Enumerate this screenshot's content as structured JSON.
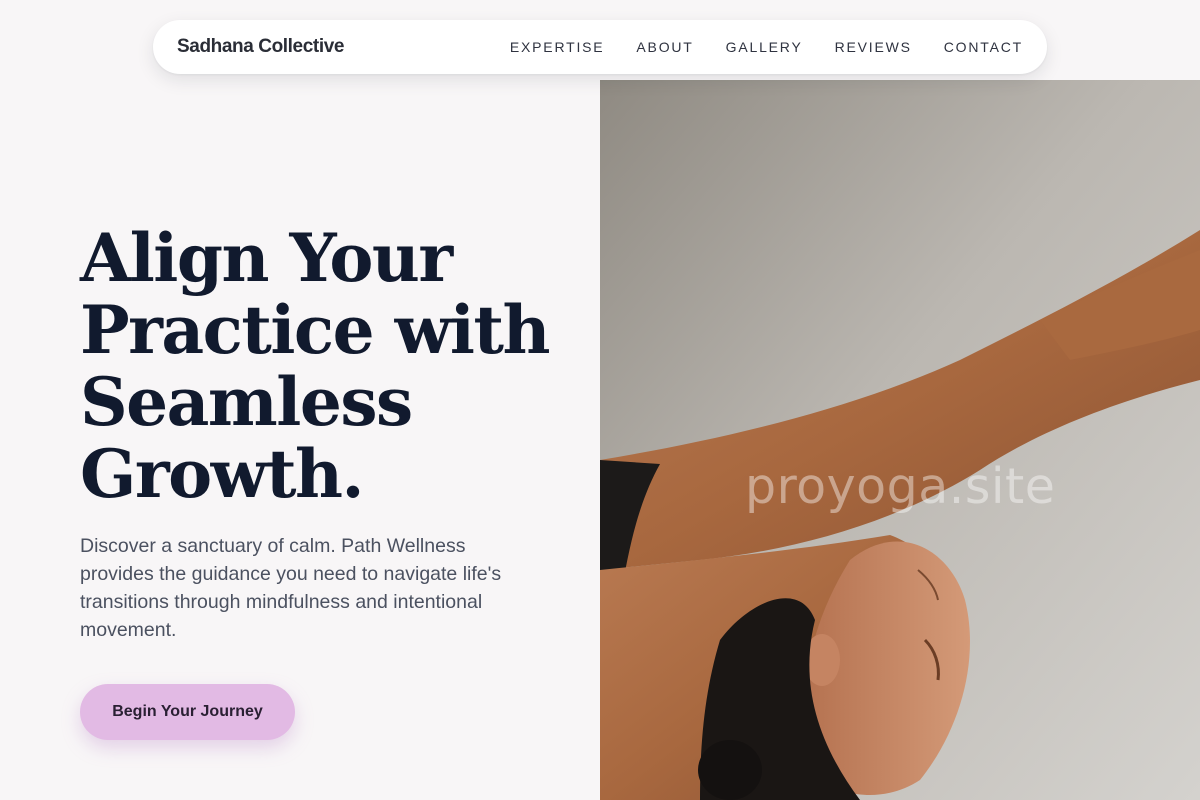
{
  "nav": {
    "brand": "Sadhana Collective",
    "links": [
      "EXPERTISE",
      "ABOUT",
      "GALLERY",
      "REVIEWS",
      "CONTACT"
    ]
  },
  "hero": {
    "title": "Align Your Practice with Seamless Growth.",
    "subtitle": "Discover a sanctuary of calm. Path Wellness provides the guidance you need to navigate life's transitions through mindfulness and intentional movement.",
    "cta_label": "Begin Your Journey"
  },
  "image": {
    "subject": "woman in inverted yoga pose",
    "watermark": "proyoga.site"
  },
  "colors": {
    "background": "#f8f6f7",
    "heading": "#111a2e",
    "body_text": "#4b5160",
    "cta_bg": "#e2bae4",
    "navbar_bg": "#ffffff"
  }
}
